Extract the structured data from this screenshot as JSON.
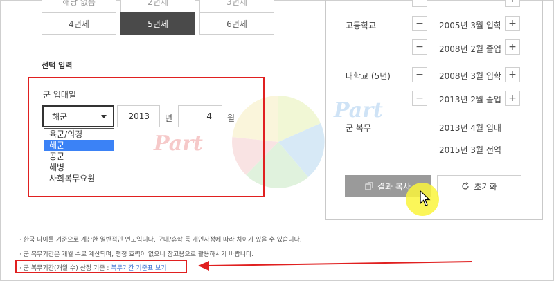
{
  "year_buttons": {
    "row_top": [
      "해당 없음",
      "2년제",
      "3년제"
    ],
    "row_main": [
      {
        "label": "4년제",
        "active": false
      },
      {
        "label": "5년제",
        "active": true
      },
      {
        "label": "6년제",
        "active": false
      }
    ]
  },
  "section": {
    "title": "선택 입력"
  },
  "military_entry": {
    "label": "군 입대일",
    "branch_selected": "해군",
    "branch_options": [
      "육군/의경",
      "해군",
      "공군",
      "해병",
      "사회복무요원"
    ],
    "year_value": "2013",
    "year_unit": "년",
    "month_value": "4",
    "month_unit": "월"
  },
  "results": {
    "rows": [
      {
        "label": "고등학교",
        "entries": [
          "2005년 3월 입학",
          "2008년 2월 졸업"
        ]
      },
      {
        "label": "대학교 (5년)",
        "entries": [
          "2008년 3월 입학",
          "2013년 2월 졸업"
        ]
      },
      {
        "label": "군 복무",
        "entries": [
          "2013년 4월 입대",
          "2015년 3월 전역"
        ]
      }
    ],
    "minus_symbol": "−",
    "plus_symbol": "+"
  },
  "actions": {
    "copy_label": "결과 복사",
    "reset_label": "초기화"
  },
  "notes": {
    "line1": "· 한국 나이를 기준으로 계산한 일반적인 연도입니다. 군대/휴학 등 개인사정에 따라 차이가 있을 수 있습니다.",
    "line2": "· 군 복무기간은 개월 수로 계산되며, 행정 효력이 없으니 참고용으로 활용하시기 바랍니다.",
    "line3_prefix": "· 군 복무기간(개월 수) 산정 기준 : ",
    "line3_link": "복무기간 기준표 보기"
  },
  "watermark_text": "Part",
  "colors": {
    "annotation_red": "#e02020",
    "selected_option": "#3b82f6",
    "cursor_highlight": "#faf53c"
  }
}
